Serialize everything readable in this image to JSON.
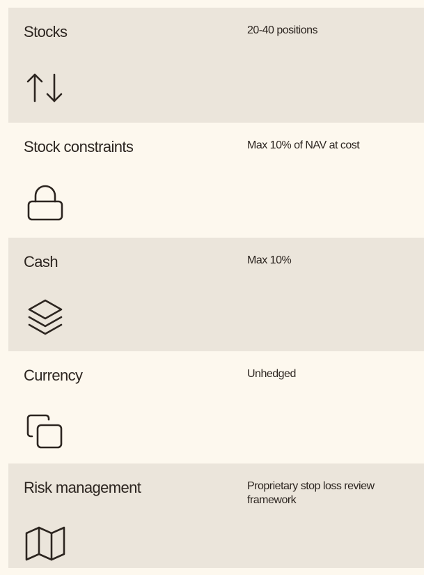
{
  "rows": [
    {
      "label": "Stocks",
      "value": "20-40 positions",
      "icon": "arrows-up-down-icon"
    },
    {
      "label": "Stock constraints",
      "value": "Max 10% of NAV at cost",
      "icon": "lock-icon"
    },
    {
      "label": "Cash",
      "value": "Max 10%",
      "icon": "layers-icon"
    },
    {
      "label": "Currency",
      "value": "Unhedged",
      "icon": "copy-icon"
    },
    {
      "label": "Risk management",
      "value": "Proprietary stop loss review framework",
      "icon": "map-icon"
    }
  ],
  "colors": {
    "shaded_bg": "#ebe5db",
    "plain_bg": "#fdf8ee",
    "text": "#2c2520"
  }
}
